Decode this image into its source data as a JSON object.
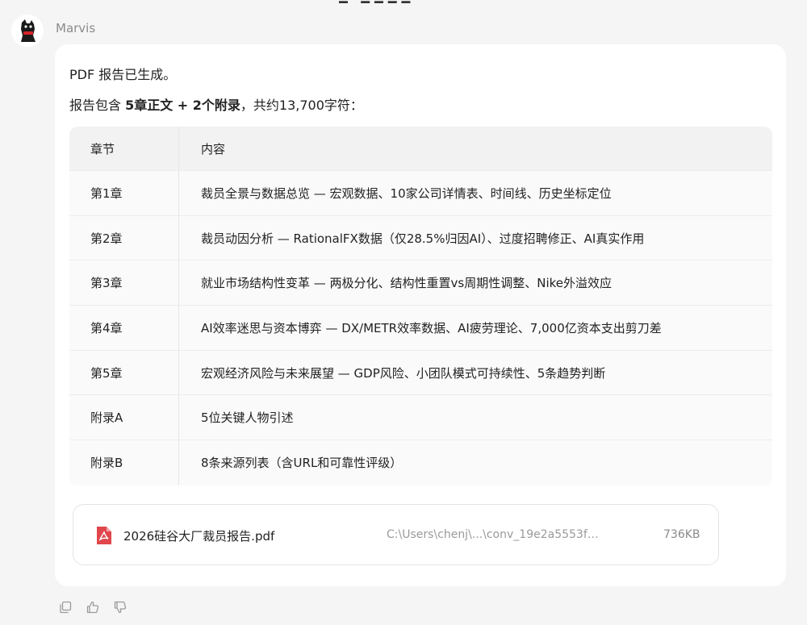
{
  "sender": {
    "name": "Marvis"
  },
  "message": {
    "line1": "PDF 报告已生成。",
    "line2_prefix": "报告包含 ",
    "line2_bold": "5章正文 + 2个附录",
    "line2_suffix": "，共约13,700字符："
  },
  "table": {
    "headers": [
      "章节",
      "内容"
    ],
    "rows": [
      {
        "chapter": "第1章",
        "content": "裁员全景与数据总览 — 宏观数据、10家公司详情表、时间线、历史坐标定位"
      },
      {
        "chapter": "第2章",
        "content": "裁员动因分析 — RationalFX数据（仅28.5%归因AI）、过度招聘修正、AI真实作用"
      },
      {
        "chapter": "第3章",
        "content": "就业市场结构性变革 — 两极分化、结构性重置vs周期性调整、Nike外溢效应"
      },
      {
        "chapter": "第4章",
        "content": "AI效率迷思与资本博弈 — DX/METR效率数据、AI疲劳理论、7,000亿资本支出剪刀差"
      },
      {
        "chapter": "第5章",
        "content": "宏观经济风险与未来展望 — GDP风险、小团队模式可持续性、5条趋势判断"
      },
      {
        "chapter": "附录A",
        "content": "5位关键人物引述"
      },
      {
        "chapter": "附录B",
        "content": "8条来源列表（含URL和可靠性评级）"
      }
    ]
  },
  "file": {
    "name": "2026硅谷大厂裁员报告.pdf",
    "path": "C:\\Users\\chenj\\...\\conv_19e2a5553f…",
    "size": "736KB",
    "icon": "pdf-file-icon",
    "icon_color": "#e0464b"
  },
  "actions": [
    {
      "icon": "copy-icon"
    },
    {
      "icon": "thumbs-up-icon"
    },
    {
      "icon": "thumbs-down-icon"
    }
  ]
}
